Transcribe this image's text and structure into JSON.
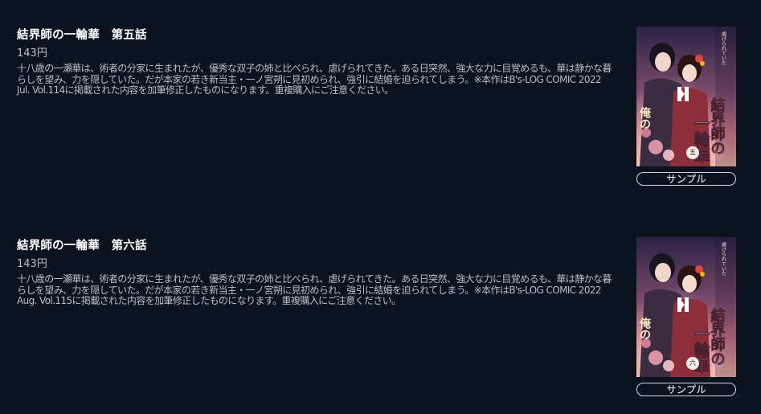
{
  "episodes": [
    {
      "title": "結界師の一輪華　第五話",
      "price": "143円",
      "description": "十八歳の一瀬華は、術者の分家に生まれたが、優秀な双子の姉と比べられ、虐げられてきた。ある日突然、強大な力に目覚めるも、華は静かな暮らしを望み、力を隠していた。だが本家の若き新当主・一ノ宮朔に見初められ、強引に結婚を迫られてしまう。※本作はB's-LOG COMIC 2022 Jul. Vol.114に掲載された内容を加筆修正したものになります。重複購入にご注意ください。",
      "sample_label": "サンプル",
      "cover": {
        "title_text": "結界師の一輪華",
        "volume_badge": "五",
        "icon": "play-pause-icon"
      }
    },
    {
      "title": "結界師の一輪華　第六話",
      "price": "143円",
      "description": "十八歳の一瀬華は、術者の分家に生まれたが、優秀な双子の姉と比べられ、虐げられてきた。ある日突然、強大な力に目覚めるも、華は静かな暮らしを望み、力を隠していた。だが本家の若き新当主・一ノ宮朔に見初められ、強引に結婚を迫られてしまう。※本作はB's-LOG COMIC 2022 Aug. Vol.115に掲載された内容を加筆修正したものになります。重複購入にご注意ください。",
      "sample_label": "サンプル",
      "cover": {
        "title_text": "結界師の一輪華",
        "volume_badge": "六",
        "icon": "play-pause-icon"
      }
    }
  ],
  "colors": {
    "background": "#0b131e",
    "title": "#ffffff",
    "body_text": "#b9bec6",
    "button_border": "#d7dbe1"
  }
}
